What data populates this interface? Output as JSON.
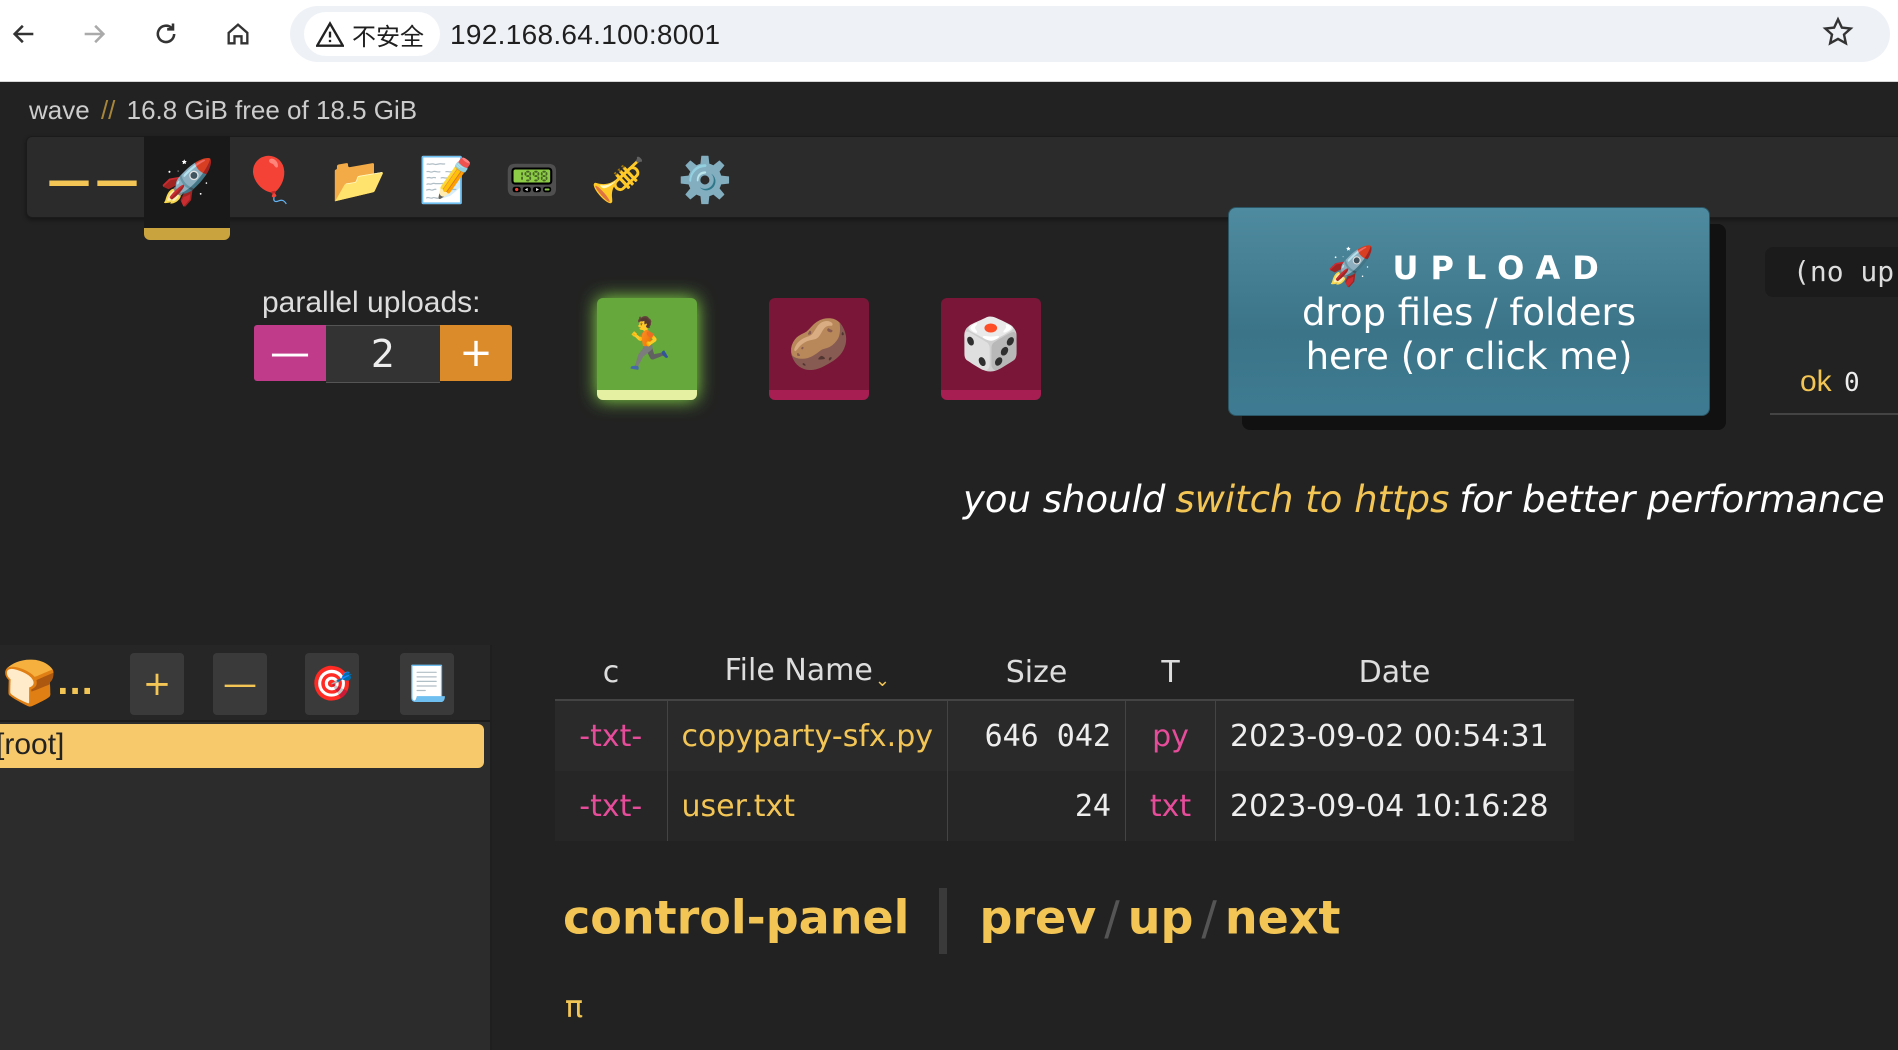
{
  "browser": {
    "security_label": "不安全",
    "url": "192.168.64.100:8001"
  },
  "header": {
    "volume": "wave",
    "separator": "//",
    "disk": "16.8 GiB free of 18.5 GiB"
  },
  "tabs": [
    {
      "name": "tab-toggle",
      "glyph": "——"
    },
    {
      "name": "tab-upload",
      "glyph": "🚀",
      "active": true
    },
    {
      "name": "tab-bup",
      "glyph": "🎈"
    },
    {
      "name": "tab-mkdir",
      "glyph": "📂"
    },
    {
      "name": "tab-new-md",
      "glyph": "📝"
    },
    {
      "name": "tab-msg",
      "glyph": "📟"
    },
    {
      "name": "tab-unpost",
      "glyph": "🎺"
    },
    {
      "name": "tab-settings",
      "glyph": "⚙️"
    }
  ],
  "upload_panel": {
    "parallel_label": "parallel uploads:",
    "parallel_value": "2",
    "minus": "—",
    "plus": "+",
    "mode_run_icon": "🏃",
    "mode_potato_icon": "🥔",
    "mode_dice_icon": "🎲",
    "upload_icon": "🚀",
    "upload_title": "UPLOAD",
    "upload_sub_1": "drop files / folders",
    "upload_sub_2": "here (or click me)",
    "no_up": "(no up",
    "ok_label": "ok",
    "ok_count": "0"
  },
  "https_hint": {
    "pre": "you should",
    "link": "switch to https",
    "post": "for better performance"
  },
  "tree": {
    "crumb_icon": "🍞",
    "crumb_more": "...",
    "btn_plus": "+",
    "btn_minus": "—",
    "btn_target": "🎯",
    "btn_page": "📃",
    "root_label": "[root]"
  },
  "files": {
    "headers": [
      "c",
      "File Name",
      "Size",
      "T",
      "Date"
    ],
    "sort_marker": "⌄",
    "rows": [
      {
        "tag": "-txt-",
        "name": "copyparty-sfx.py",
        "size": "646 042",
        "type": "py",
        "date": "2023-09-02 00:54:31"
      },
      {
        "tag": "-txt-",
        "name": "user.txt",
        "size": "24",
        "type": "txt",
        "date": "2023-09-04 10:16:28"
      }
    ]
  },
  "footer_nav": {
    "control_panel": "control-panel",
    "prev": "prev",
    "up": "up",
    "next": "next",
    "slash": "/",
    "pi": "π"
  },
  "colors": {
    "accent": "#f2c555",
    "pink": "#e74c9b",
    "upload_bg": "#3b7488",
    "bg": "#222222"
  }
}
